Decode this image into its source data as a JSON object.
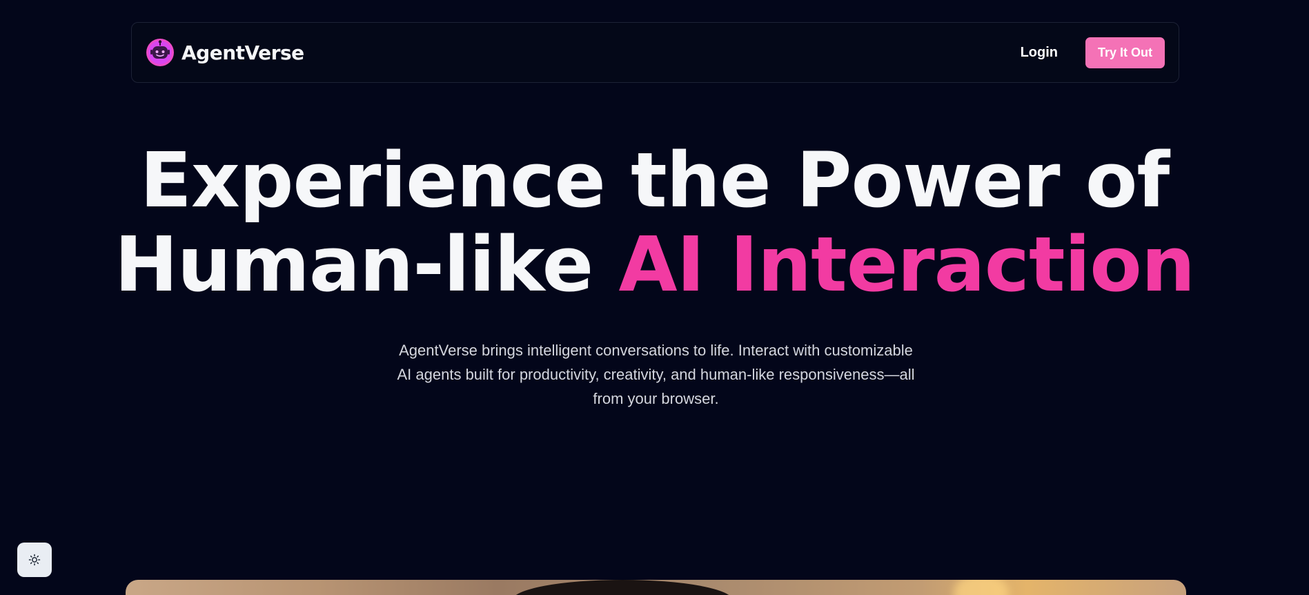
{
  "header": {
    "brand_name": "AgentVerse",
    "logo_icon": "robot-face-icon",
    "login_label": "Login",
    "cta_label": "Try It Out"
  },
  "hero": {
    "title_line1": "Experience the Power of",
    "title_line2_plain": "Human-like ",
    "title_line2_accent": "AI Interaction",
    "subtitle": "AgentVerse brings intelligent conversations to life. Interact with customizable AI agents built for productivity, creativity, and human-like responsiveness—all from your browser."
  },
  "theme_toggle": {
    "icon": "sun-icon"
  },
  "colors": {
    "background": "#03061a",
    "accent": "#f23ba2",
    "cta": "#f472b6",
    "text": "#f6f7f9"
  }
}
